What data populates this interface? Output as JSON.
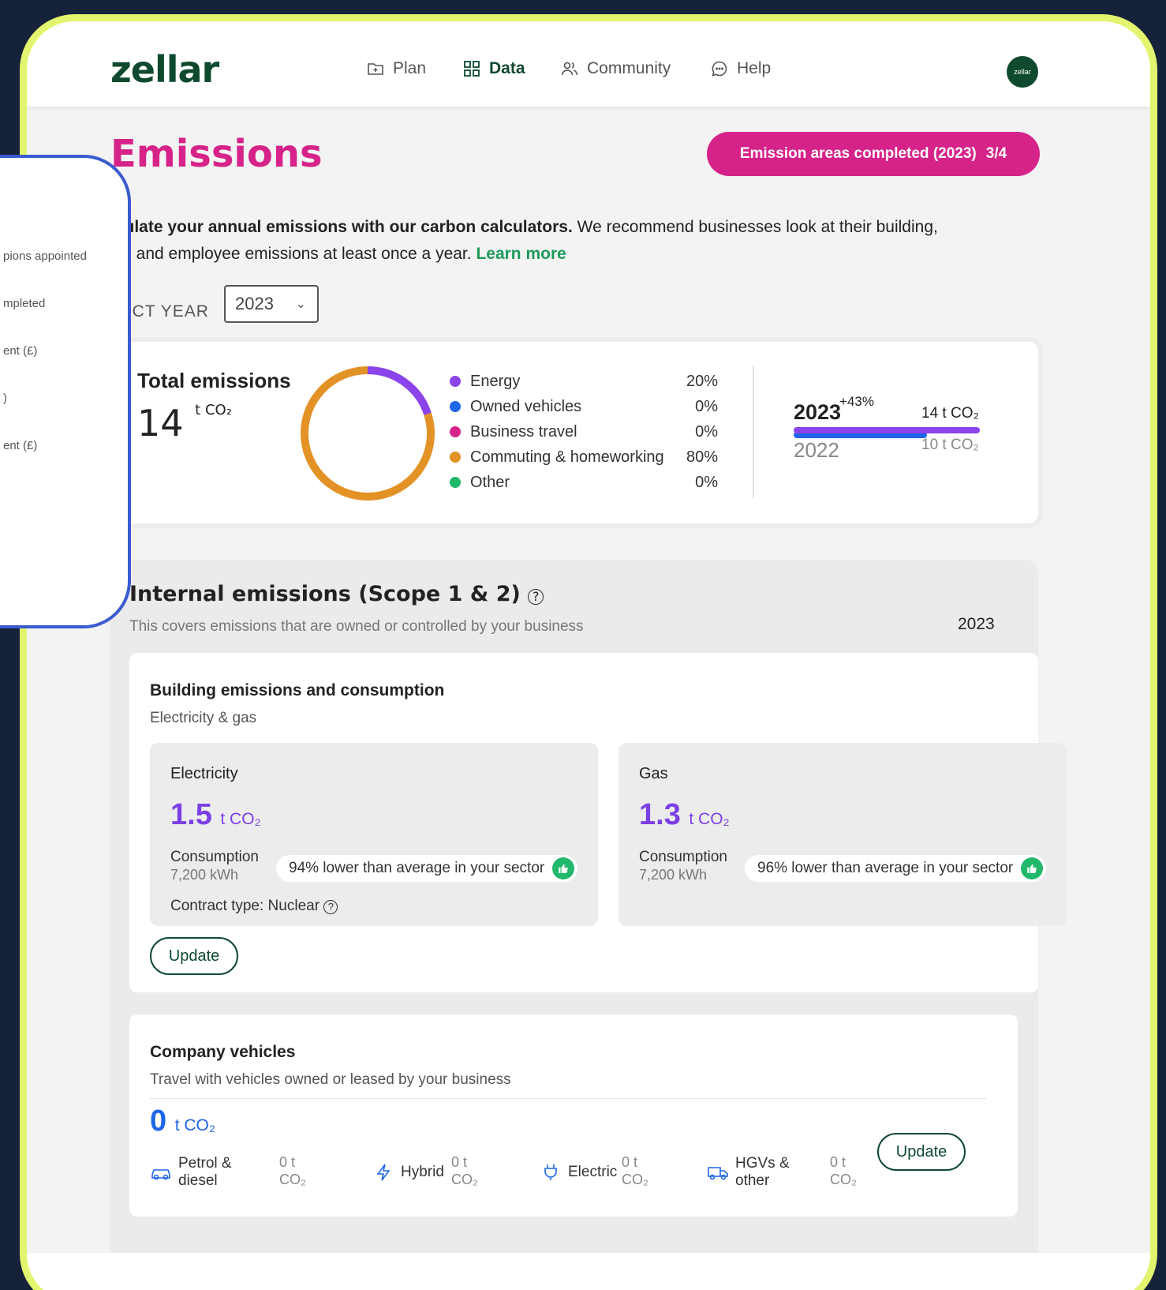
{
  "brand": {
    "logo": "zellar",
    "avatar_text": "zellar"
  },
  "nav": [
    {
      "label": "Plan",
      "icon": "plan-icon"
    },
    {
      "label": "Data",
      "icon": "grid-icon"
    },
    {
      "label": "Community",
      "icon": "people-icon"
    },
    {
      "label": "Help",
      "icon": "chat-icon"
    }
  ],
  "page": {
    "title": "Emissions",
    "progress_label": "Emission areas completed (2023)",
    "progress_value": "3/4",
    "intro_bold": "lculate your annual emissions with our carbon calculators.",
    "intro_rest_1": " We recommend businesses look at their building,",
    "intro_rest_2": "vel and employee emissions at least once a year.",
    "learn_more": "Learn more",
    "year_label": "LECT YEAR",
    "year_value": "2023"
  },
  "side_panel": {
    "items": [
      "pions appointed",
      "mpleted",
      "ent (£)",
      ")",
      "ent (£)"
    ]
  },
  "total": {
    "title": "Total emissions",
    "value": "14",
    "unit": "t CO₂",
    "legend": [
      {
        "label": "Energy",
        "pct": "20%",
        "value": 20,
        "color": "#8b43ea"
      },
      {
        "label": "Owned vehicles",
        "pct": "0%",
        "value": 0,
        "color": "#1f66e8"
      },
      {
        "label": "Business travel",
        "pct": "0%",
        "value": 0,
        "color": "#d6238a"
      },
      {
        "label": "Commuting & homeworking",
        "pct": "80%",
        "value": 80,
        "color": "#e39225"
      },
      {
        "label": "Other",
        "pct": "0%",
        "value": 0,
        "color": "#22b86b"
      }
    ],
    "compare": {
      "year_current": "2023",
      "delta": "+43%",
      "current_value": "14 t CO₂",
      "current_amount": 14,
      "year_prev": "2022",
      "prev_value": "10 t CO₂",
      "prev_amount": 10
    }
  },
  "internal": {
    "title": "Internal emissions (Scope 1 & 2)",
    "subtitle": "This covers emissions that are owned or controlled by your business",
    "year": "2023"
  },
  "building": {
    "title": "Building emissions and consumption",
    "subtitle": "Electricity & gas",
    "electricity": {
      "title": "Electricity",
      "value": "1.5",
      "unit": "t CO₂",
      "cons_label": "Consumption",
      "cons_value": "7,200 kWh",
      "badge": "94% lower than average in your sector",
      "contract": "Contract type: Nuclear"
    },
    "gas": {
      "title": "Gas",
      "value": "1.3",
      "unit": "t CO₂",
      "cons_label": "Consumption",
      "cons_value": "7,200 kWh",
      "badge": "96% lower than average in your sector"
    },
    "update_label": "Update"
  },
  "vehicles": {
    "title": "Company vehicles",
    "subtitle": "Travel with vehicles owned or leased by your business",
    "value": "0",
    "unit": "t CO₂",
    "items": [
      {
        "label_1": "Petrol &",
        "label_2": "diesel",
        "t": "0 t",
        "co2": "CO₂"
      },
      {
        "label_1": "Hybrid",
        "label_2": "",
        "t": "0 t",
        "co2": "CO₂"
      },
      {
        "label_1": "Electric",
        "label_2": "",
        "t": "0 t",
        "co2": "CO₂"
      },
      {
        "label_1": "HGVs &",
        "label_2": "other",
        "t": "0 t",
        "co2": "CO₂"
      }
    ],
    "update_label": "Update"
  }
}
